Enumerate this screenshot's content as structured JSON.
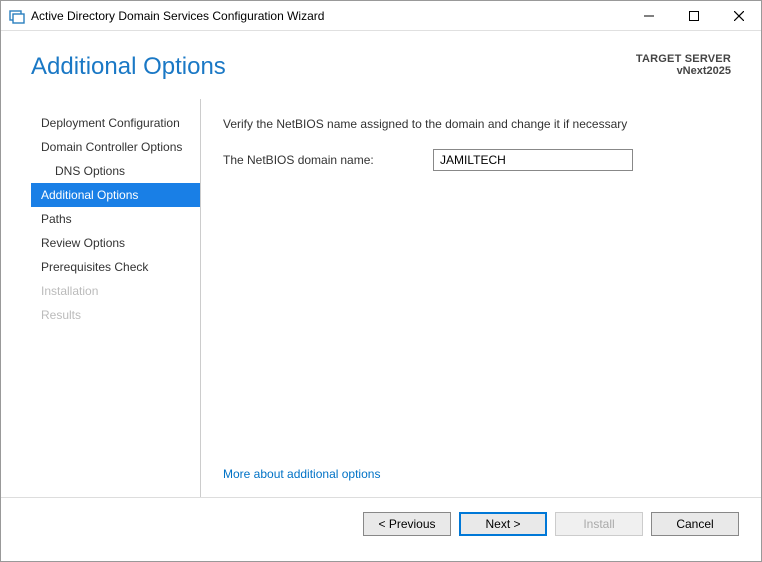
{
  "window": {
    "title": "Active Directory Domain Services Configuration Wizard"
  },
  "header": {
    "page_title": "Additional Options",
    "target_label": "TARGET SERVER",
    "target_name": "vNext2025"
  },
  "nav": {
    "items": [
      {
        "label": "Deployment Configuration",
        "indent": false,
        "state": "normal"
      },
      {
        "label": "Domain Controller Options",
        "indent": false,
        "state": "normal"
      },
      {
        "label": "DNS Options",
        "indent": true,
        "state": "normal"
      },
      {
        "label": "Additional Options",
        "indent": false,
        "state": "selected"
      },
      {
        "label": "Paths",
        "indent": false,
        "state": "normal"
      },
      {
        "label": "Review Options",
        "indent": false,
        "state": "normal"
      },
      {
        "label": "Prerequisites Check",
        "indent": false,
        "state": "normal"
      },
      {
        "label": "Installation",
        "indent": false,
        "state": "disabled"
      },
      {
        "label": "Results",
        "indent": false,
        "state": "disabled"
      }
    ]
  },
  "content": {
    "instruction": "Verify the NetBIOS name assigned to the domain and change it if necessary",
    "field_label": "The NetBIOS domain name:",
    "field_value": "JAMILTECH",
    "more_link": "More about additional options"
  },
  "footer": {
    "previous": "< Previous",
    "next": "Next >",
    "install": "Install",
    "cancel": "Cancel"
  }
}
